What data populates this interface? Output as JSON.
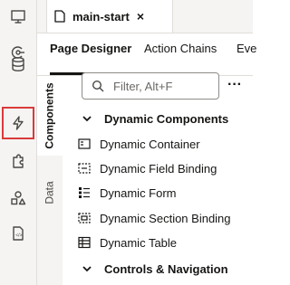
{
  "rail": {
    "items": [
      {
        "icon": "monitor-icon",
        "name": "rail-web-apps"
      },
      {
        "icon": "services-icon",
        "name": "rail-services"
      },
      {
        "icon": "database-icon",
        "name": "rail-business-objects"
      },
      {
        "icon": "lightning-icon",
        "name": "rail-action-chains",
        "selected": true
      },
      {
        "icon": "puzzle-icon",
        "name": "rail-components"
      },
      {
        "icon": "shapes-icon",
        "name": "rail-layouts"
      },
      {
        "icon": "document-icon",
        "name": "rail-source"
      }
    ]
  },
  "editor_tab": {
    "label": "main-start",
    "close": "×"
  },
  "designer_tabs": [
    "Page Designer",
    "Action Chains",
    "Eve"
  ],
  "side_tabs": {
    "components": "Components",
    "data": "Data"
  },
  "palette": {
    "filter_placeholder": "Filter, Alt+F",
    "more": "···",
    "groups": [
      {
        "label": "Dynamic Components",
        "items": [
          {
            "label": "Dynamic Container",
            "icon": "dynamic-container-icon"
          },
          {
            "label": "Dynamic Field Binding",
            "icon": "dynamic-field-binding-icon"
          },
          {
            "label": "Dynamic Form",
            "icon": "dynamic-form-icon"
          },
          {
            "label": "Dynamic Section Binding",
            "icon": "dynamic-section-binding-icon"
          },
          {
            "label": "Dynamic Table",
            "icon": "dynamic-table-icon"
          }
        ]
      },
      {
        "label": "Controls & Navigation",
        "items": []
      }
    ]
  },
  "colors": {
    "highlight": "#d93b3b",
    "rail_bg": "#f5f4f2",
    "text": "#161513"
  }
}
